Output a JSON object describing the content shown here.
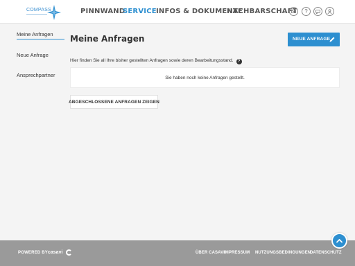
{
  "header": {
    "logo_text": "COMPASS",
    "nav": [
      {
        "label": "PINNWAND"
      },
      {
        "label": "SERVICE"
      },
      {
        "label": "INFOS & DOKUMENTE"
      },
      {
        "label": "NACHBARSCHAFT"
      }
    ],
    "active_nav": "SERVICE",
    "icons": [
      "mail-icon",
      "help-icon",
      "chat-icon",
      "user-icon"
    ],
    "accent_color": "#2d8fd0"
  },
  "sidebar": {
    "items": [
      {
        "label": "Meine Anfragen",
        "active": true
      },
      {
        "label": "Neue Anfrage"
      },
      {
        "label": "Ansprechpartner"
      }
    ]
  },
  "main": {
    "title": "Meine Anfragen",
    "new_request_label": "NEUE ANFRAGE",
    "description": "Hier finden Sie all Ihre bisher gestellten Anfragen sowie deren Bearbeitungsstand.",
    "empty_message": "Sie haben noch keine Anfragen gestellt.",
    "show_closed_label": "ABGESCHLOSSENE ANFRAGEN ZEIGEN"
  },
  "footer": {
    "powered_by": "POWERED BY",
    "brand": "casavi",
    "links": [
      "ÜBER CASAVI",
      "IMPRESSUM",
      "NUTZUNGSBEDINGUNGEN",
      "DATENSCHUTZ"
    ]
  }
}
